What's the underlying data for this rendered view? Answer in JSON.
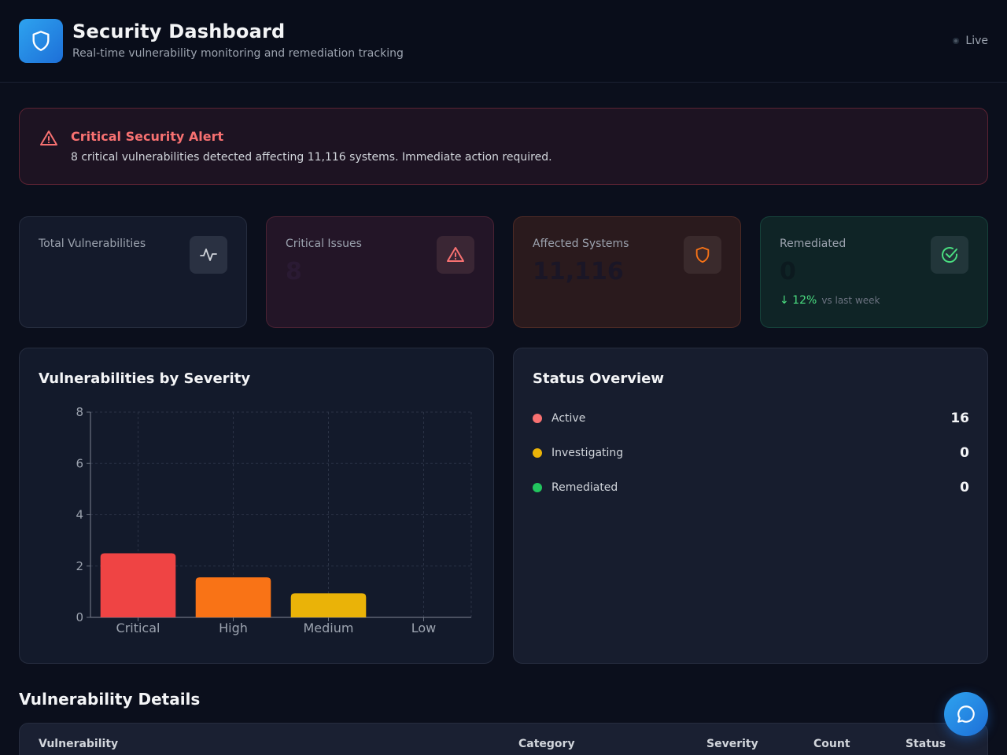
{
  "header": {
    "title": "Security Dashboard",
    "subtitle": "Real-time vulnerability monitoring and remediation tracking",
    "live_label": "Live",
    "logo_icon": "shield-icon"
  },
  "alert": {
    "title": "Critical Security Alert",
    "message": "8 critical vulnerabilities detected affecting 11,116 systems. Immediate action required.",
    "icon": "warning-triangle-icon"
  },
  "cards": [
    {
      "label": "Total Vulnerabilities",
      "value": "",
      "icon": "activity-icon"
    },
    {
      "label": "Critical Issues",
      "value": "8",
      "icon": "warning-triangle-icon"
    },
    {
      "label": "Affected Systems",
      "value": "11,116",
      "icon": "shield-icon"
    },
    {
      "label": "Remediated",
      "value": "0",
      "icon": "check-circle-icon",
      "trend": "↓ 12%",
      "trend_note": "vs last week"
    }
  ],
  "severity_panel": {
    "title": "Vulnerabilities by Severity"
  },
  "chart_data": {
    "type": "bar",
    "title": "Vulnerabilities by Severity",
    "categories": [
      "Critical",
      "High",
      "Medium",
      "Low"
    ],
    "values": [
      2.5,
      1.56,
      0.94,
      0
    ],
    "colors": [
      "#ef4444",
      "#f97316",
      "#eab308",
      "#22c55e"
    ],
    "ylim": [
      0,
      8
    ],
    "yticks": [
      0,
      2,
      4,
      6,
      8
    ],
    "grid": true
  },
  "status_panel": {
    "title": "Status Overview",
    "items": [
      {
        "label": "Active",
        "count": "16",
        "color": "#f87171"
      },
      {
        "label": "Investigating",
        "count": "0",
        "color": "#eab308"
      },
      {
        "label": "Remediated",
        "count": "0",
        "color": "#22c55e"
      }
    ]
  },
  "details": {
    "title": "Vulnerability Details",
    "columns": [
      "Vulnerability",
      "Category",
      "Severity",
      "Count",
      "Status"
    ]
  },
  "chat": {
    "icon": "chat-bubble-icon"
  }
}
